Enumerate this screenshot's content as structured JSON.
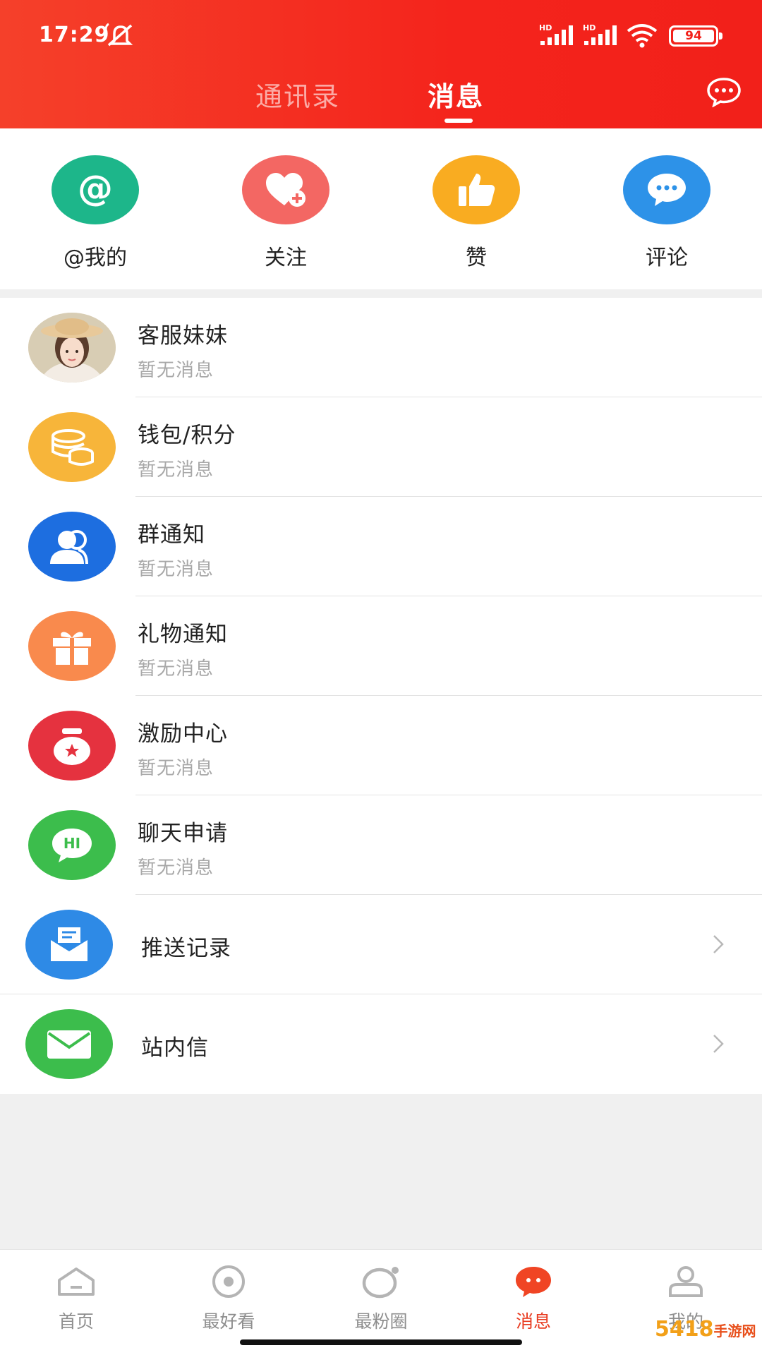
{
  "status_bar": {
    "time": "17:29",
    "signal_labels": [
      "HD",
      "HD"
    ],
    "battery": "94"
  },
  "header": {
    "tabs": [
      {
        "label": "通讯录",
        "active": false
      },
      {
        "label": "消息",
        "active": true
      }
    ],
    "chat_icon": "chat-bubble-icon",
    "gradient": [
      "#f5402a",
      "#f2201a"
    ]
  },
  "quick_actions": [
    {
      "label": "@我的",
      "icon": "at-icon",
      "color": "#1db68a"
    },
    {
      "label": "关注",
      "icon": "heart-plus-icon",
      "color": "#f36763"
    },
    {
      "label": "赞",
      "icon": "thumbs-up-icon",
      "color": "#f9ac21"
    },
    {
      "label": "评论",
      "icon": "comment-icon",
      "color": "#2d92e8"
    }
  ],
  "messages": [
    {
      "title": "客服妹妹",
      "subtitle": "暂无消息",
      "icon": "avatar"
    },
    {
      "title": "钱包/积分",
      "subtitle": "暂无消息",
      "icon": "coins-icon",
      "color": "#f7b53a"
    },
    {
      "title": "群通知",
      "subtitle": "暂无消息",
      "icon": "group-icon",
      "color": "#1d6ee0"
    },
    {
      "title": "礼物通知",
      "subtitle": "暂无消息",
      "icon": "gift-icon",
      "color": "#f98a4d"
    },
    {
      "title": "激励中心",
      "subtitle": "暂无消息",
      "icon": "reward-icon",
      "color": "#e5323f"
    },
    {
      "title": "聊天申请",
      "subtitle": "暂无消息",
      "icon": "hi-icon",
      "color": "#3cbd4c"
    }
  ],
  "links": [
    {
      "title": "推送记录",
      "icon": "push-record-icon",
      "color": "#2e8ae6"
    },
    {
      "title": "站内信",
      "icon": "mail-icon",
      "color": "#3cbd4c"
    }
  ],
  "bottom_nav": [
    {
      "label": "首页",
      "icon": "home-icon",
      "active": false
    },
    {
      "label": "最好看",
      "icon": "eye-icon",
      "active": false
    },
    {
      "label": "最粉圈",
      "icon": "circle-icon",
      "active": false
    },
    {
      "label": "消息",
      "icon": "message-icon",
      "active": true
    },
    {
      "label": "我的",
      "icon": "profile-icon",
      "active": false
    }
  ],
  "watermark": {
    "main": "5418",
    "sub": "手游网"
  }
}
